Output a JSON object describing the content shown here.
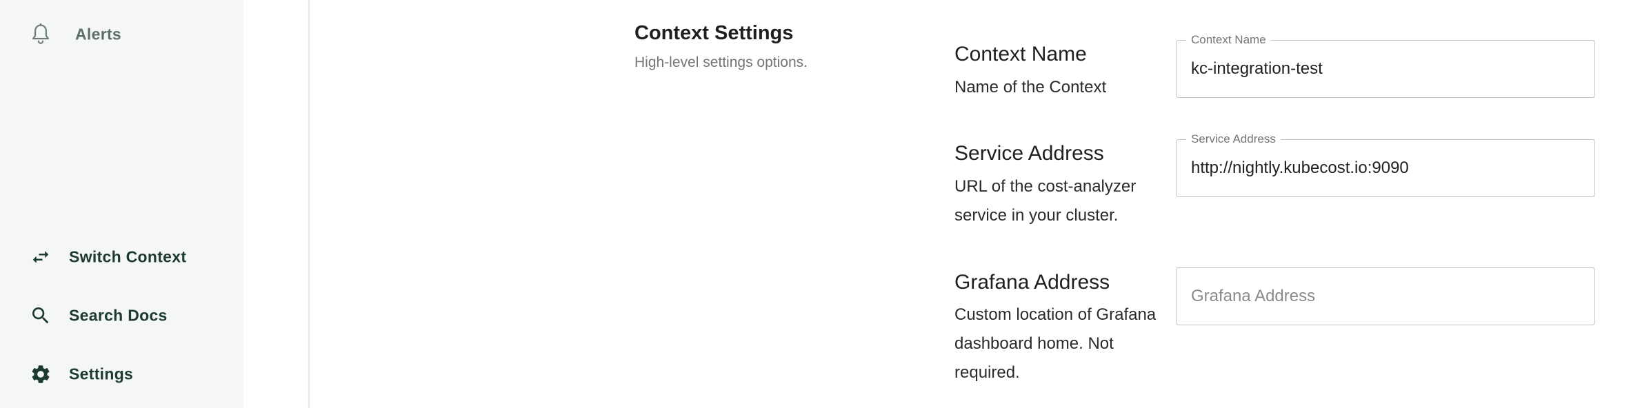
{
  "sidebar": {
    "items": [
      {
        "label": "Alerts",
        "icon": "bell-icon"
      },
      {
        "label": "Switch Context",
        "icon": "swap-arrows-icon"
      },
      {
        "label": "Search Docs",
        "icon": "search-icon"
      },
      {
        "label": "Settings",
        "icon": "gear-icon"
      }
    ]
  },
  "section": {
    "title": "Context Settings",
    "subtitle": "High-level settings options."
  },
  "fields": {
    "context_name": {
      "title": "Context Name",
      "description": "Name of the Context",
      "legend": "Context Name",
      "value": "kc-integration-test"
    },
    "service_address": {
      "title": "Service Address",
      "description": "URL of the cost-analyzer service in your cluster.",
      "legend": "Service Address",
      "value": "http://nightly.kubecost.io:9090"
    },
    "grafana_address": {
      "title": "Grafana Address",
      "description": "Custom location of Grafana dashboard home. Not required.",
      "placeholder": "Grafana Address",
      "value": ""
    }
  },
  "colors": {
    "sidebar_bg": "#f4f7f4",
    "nav_text": "#1d3a2e",
    "muted_text": "#757575"
  }
}
